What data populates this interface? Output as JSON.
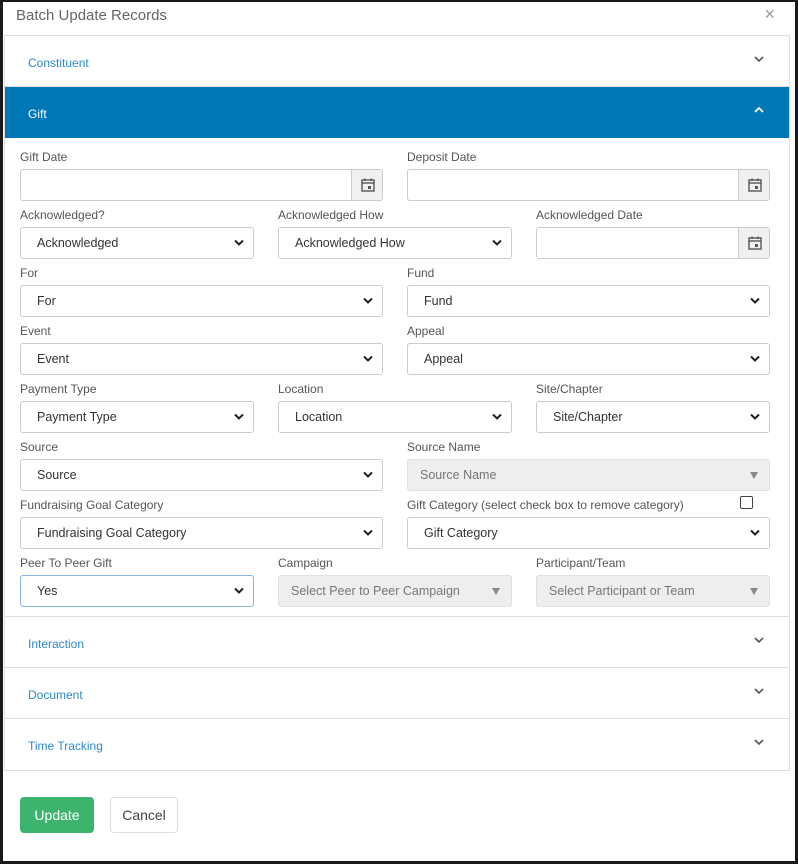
{
  "dialog": {
    "title": "Batch Update Records",
    "close_glyph": "×"
  },
  "sections": {
    "constituent": "Constituent",
    "gift": "Gift",
    "interaction": "Interaction",
    "document": "Document",
    "time_tracking": "Time Tracking"
  },
  "gift": {
    "gift_date": {
      "label": "Gift Date",
      "value": ""
    },
    "deposit_date": {
      "label": "Deposit Date",
      "value": ""
    },
    "acknowledged": {
      "label": "Acknowledged?",
      "value": "Acknowledged"
    },
    "acknowledged_how": {
      "label": "Acknowledged How",
      "value": "Acknowledged How"
    },
    "acknowledged_date": {
      "label": "Acknowledged Date",
      "value": ""
    },
    "for": {
      "label": "For",
      "value": "For"
    },
    "fund": {
      "label": "Fund",
      "value": "Fund"
    },
    "event": {
      "label": "Event",
      "value": "Event"
    },
    "appeal": {
      "label": "Appeal",
      "value": "Appeal"
    },
    "payment_type": {
      "label": "Payment Type",
      "value": "Payment Type"
    },
    "location": {
      "label": "Location",
      "value": "Location"
    },
    "site_chapter": {
      "label": "Site/Chapter",
      "value": "Site/Chapter"
    },
    "source": {
      "label": "Source",
      "value": "Source"
    },
    "source_name": {
      "label": "Source Name",
      "value": "Source Name"
    },
    "fundraising_goal_category": {
      "label": "Fundraising Goal Category",
      "value": "Fundraising Goal Category"
    },
    "gift_category": {
      "label": "Gift Category (select check box to remove category)",
      "value": "Gift Category",
      "checked": false
    },
    "peer_to_peer_gift": {
      "label": "Peer To Peer Gift",
      "value": "Yes"
    },
    "campaign": {
      "label": "Campaign",
      "value": "Select Peer to Peer Campaign"
    },
    "participant_team": {
      "label": "Participant/Team",
      "value": "Select Participant or Team"
    }
  },
  "actions": {
    "update": "Update",
    "cancel": "Cancel"
  },
  "colors": {
    "accent": "#0077b6",
    "link": "#2d8ac9",
    "success": "#3cb46e"
  }
}
